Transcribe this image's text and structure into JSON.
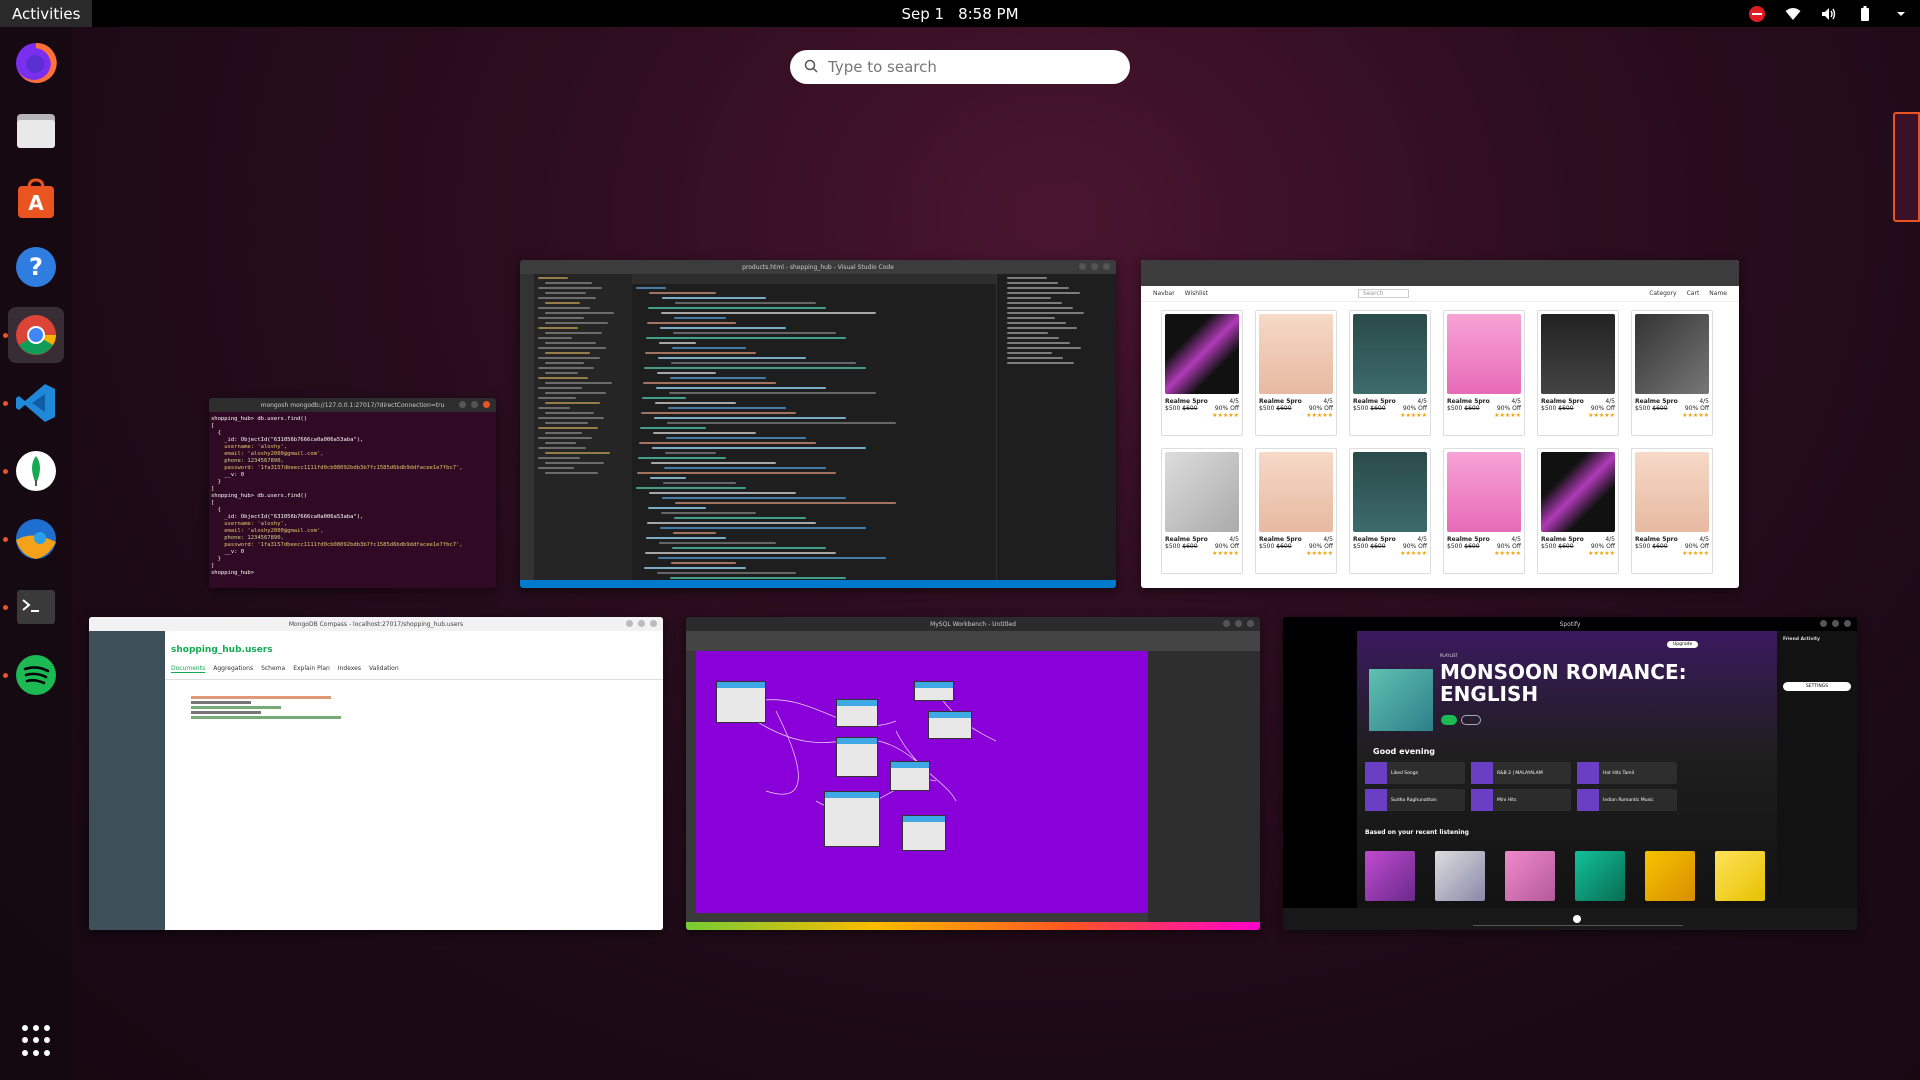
{
  "topbar": {
    "activities": "Activities",
    "date": "Sep 1",
    "time": "8:58 PM"
  },
  "search": {
    "placeholder": "Type to search"
  },
  "dock": {
    "items": [
      "firefox",
      "files",
      "ubuntu-software",
      "help",
      "chrome",
      "vscode",
      "mongodb-compass",
      "mysql-workbench",
      "terminal",
      "spotify",
      "show-applications"
    ]
  },
  "windows": {
    "terminal": {
      "title": "mongosh mongodb://127.0.0.1:27017/?directConnection=tru",
      "lines": [
        "shopping_hub> db.users.find()",
        "[",
        "  {",
        "    _id: ObjectId(\"631056b7666ca0a006a53aba\"),",
        "    username: 'aloshy',",
        "    email: 'aloshy2000@gmail.com',",
        "    phone: 1234567890,",
        "    password: '1fa3157dbeecc1111fd0cb08092bdb3b7fc1585d6bdb9ddfacee1e7fbc7',",
        "    __v: 0",
        "  }",
        "]",
        "shopping_hub> db.users.find()",
        "[",
        "  {",
        "    _id: ObjectId(\"631056b7666ca0a006a53aba\"),",
        "    username: 'aloshy',",
        "    email: 'aloshy2000@gmail.com',",
        "    phone: 1234567890,",
        "    password: '1fa3157dbeecc1111fd0cb08092bdb3b7fc1585d6bdb9ddfacee1e7fbc7',",
        "    __v: 0",
        "  }",
        "]",
        "shopping_hub> "
      ]
    },
    "vscode": {
      "title": "products.html - shopping_hub - Visual Studio Code"
    },
    "shop": {
      "nav_brand": "Navbar",
      "nav_link": "Wishlist",
      "nav_search": "Search",
      "nav_right": [
        "Category",
        "Cart",
        "Name"
      ],
      "product_name": "Realme 5pro",
      "rating": "4/5",
      "price": "$500",
      "old_price": "$600",
      "discount": "90% Off",
      "stars": "★★★★★"
    },
    "compass": {
      "title": "MongoDB Compass - localhost:27017/shopping_hub.users",
      "collection": "shopping_hub.users",
      "tabs": [
        "Documents",
        "Aggregations",
        "Schema",
        "Explain Plan",
        "Indexes",
        "Validation"
      ]
    },
    "workbench": {
      "title": "MySQL Workbench - Untitled"
    },
    "spotify": {
      "title": "Spotify",
      "playlist_label": "PLAYLIST",
      "playlist_title": "MONSOON ROMANCE: ENGLISH",
      "section_good_evening": "Good evening",
      "tiles": [
        "Liked Songs",
        "R&B 2 | MALAYALAM",
        "Hot Hits Tamil",
        "Sudha Raghunathan",
        "Mini Hits",
        "Indian Romantic Music"
      ],
      "section_recent": "Based on your recent listening",
      "upgrade": "Upgrade",
      "friend_activity": "Friend Activity",
      "settings": "SETTINGS"
    }
  },
  "colors": {
    "accent": "#e95420",
    "terminal_bg": "#300a24",
    "vscode_status": "#007acc",
    "workbench_canvas": "#8a00d8",
    "spotify_green": "#1db954"
  }
}
